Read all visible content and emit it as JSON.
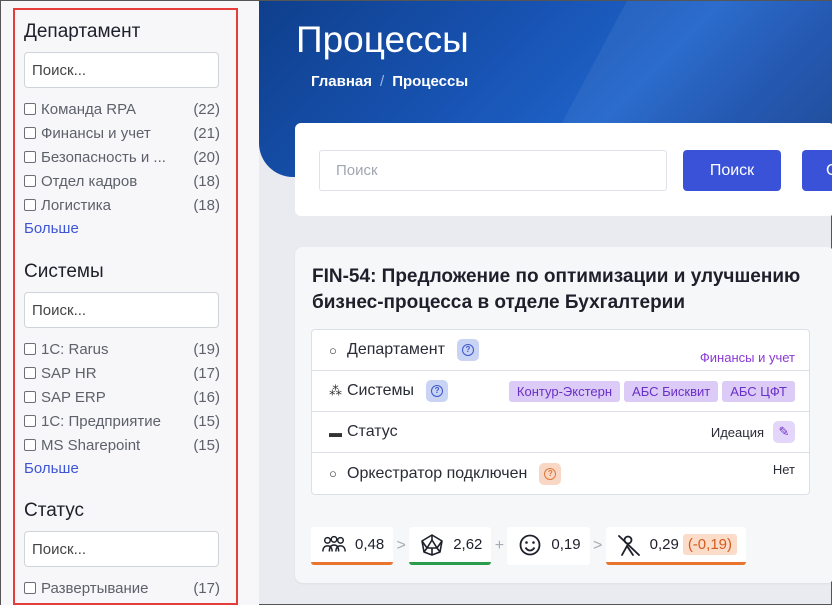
{
  "sidebar": {
    "facets": [
      {
        "title": "Департамент",
        "search_placeholder": "Поиск...",
        "items": [
          {
            "label": "Команда RPA",
            "count": "(22)"
          },
          {
            "label": "Финансы и учет",
            "count": "(21)"
          },
          {
            "label": "Безопасность и ...",
            "count": "(20)"
          },
          {
            "label": "Отдел кадров",
            "count": "(18)"
          },
          {
            "label": "Логистика",
            "count": "(18)"
          }
        ],
        "more": "Больше"
      },
      {
        "title": "Системы",
        "search_placeholder": "Поиск...",
        "items": [
          {
            "label": "1C: Rarus",
            "count": "(19)"
          },
          {
            "label": "SAP HR",
            "count": "(17)"
          },
          {
            "label": "SAP ERP",
            "count": "(16)"
          },
          {
            "label": "1C: Предприятие",
            "count": "(15)"
          },
          {
            "label": "MS Sharepoint",
            "count": "(15)"
          }
        ],
        "more": "Больше"
      },
      {
        "title": "Статус",
        "search_placeholder": "Поиск...",
        "items": [
          {
            "label": "Развертывание",
            "count": "(17)"
          }
        ]
      }
    ]
  },
  "header": {
    "title": "Процессы",
    "breadcrumb": [
      "Главная",
      "Процессы"
    ],
    "breadcrumb_sep": "/"
  },
  "search": {
    "placeholder": "Поиск",
    "button_label": "Поиск",
    "extra_button_label": "С"
  },
  "process": {
    "title": "FIN-54: Предложение по оптимизации и улучшению бизнес-процесса в отделе Бухгалтерии",
    "fields": {
      "department": {
        "label": "Департамент",
        "value": "Финансы и учет"
      },
      "systems": {
        "label": "Системы",
        "tags": [
          "Контур-Экстерн",
          "АБС Бисквит",
          "АБС ЦФТ"
        ]
      },
      "status": {
        "label": "Статус",
        "value": "Идеация"
      },
      "orchestrator": {
        "label": "Оркестратор подключен",
        "value": "Нет"
      }
    },
    "metrics": [
      {
        "value": "0,48",
        "icon": "people-group-icon",
        "bar_color": "#e8742e"
      },
      {
        "value": "2,62",
        "icon": "polyhedron-icon",
        "bar_color": "#2a9c4b"
      },
      {
        "value": "0,19",
        "icon": "smiley-icon"
      },
      {
        "value": "0,29",
        "delta": "(-0,19)",
        "icon": "cross-out-person-icon",
        "bar_color": "#e8742e"
      }
    ],
    "metric_separators": [
      ">",
      "+",
      ">"
    ]
  },
  "colors": {
    "accent": "#3a52d8",
    "sidebar_highlight": "#e53c3c",
    "tag_text": "#6a2fc6",
    "tag_bg": "#dccbf7"
  }
}
